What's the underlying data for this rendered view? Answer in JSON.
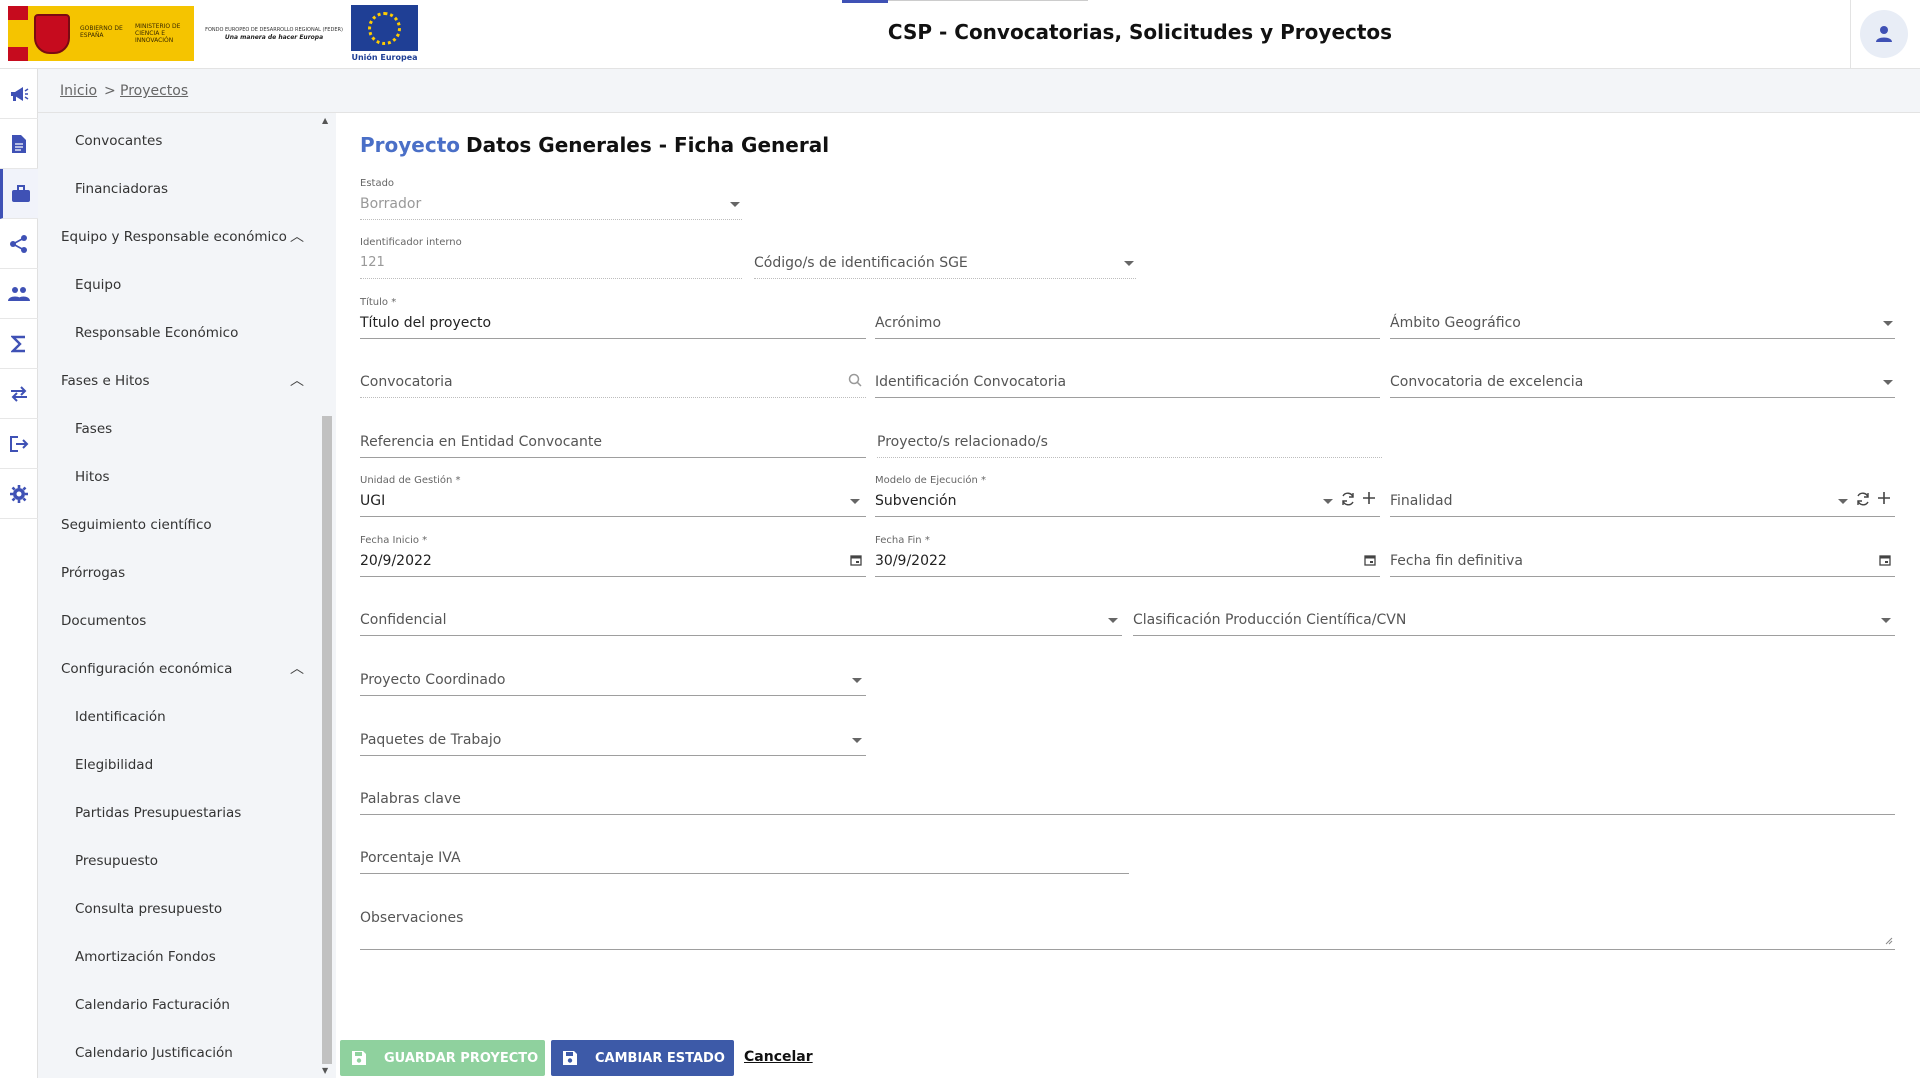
{
  "header": {
    "gov_line1": "GOBIERNO DE ESPAÑA",
    "gov_line2": "MINISTERIO DE CIENCIA E INNOVACIÓN",
    "feder_line1": "FONDO EUROPEO DE DESARROLLO REGIONAL (FEDER)",
    "feder_line2": "Una manera de hacer Europa",
    "eu_label": "Unión Europea",
    "title": "CSP - Convocatorias, Solicitudes y Proyectos"
  },
  "rail": {
    "icons": [
      "megaphone-icon",
      "document-icon",
      "briefcase-icon",
      "share-icon",
      "people-icon",
      "sigma-icon",
      "transfer-icon",
      "logout-icon",
      "gear-icon"
    ],
    "active_index": 2,
    "accent": "#3f51b5"
  },
  "breadcrumb": {
    "home": "Inicio",
    "separator": ">",
    "current": "Proyectos"
  },
  "nav": {
    "items": [
      {
        "label": "Convocantes"
      },
      {
        "label": "Financiadoras"
      },
      {
        "label": "Equipo y Responsable económico"
      },
      {
        "label": "Equipo"
      },
      {
        "label": "Responsable Económico"
      },
      {
        "label": "Fases e Hitos"
      },
      {
        "label": "Fases"
      },
      {
        "label": "Hitos"
      },
      {
        "label": "Seguimiento científico"
      },
      {
        "label": "Prórrogas"
      },
      {
        "label": "Documentos"
      },
      {
        "label": "Configuración económica"
      },
      {
        "label": "Identificación"
      },
      {
        "label": "Elegibilidad"
      },
      {
        "label": "Partidas Presupuestarias"
      },
      {
        "label": "Presupuesto"
      },
      {
        "label": "Consulta presupuesto"
      },
      {
        "label": "Amortización Fondos"
      },
      {
        "label": "Calendario Facturación"
      },
      {
        "label": "Calendario Justificación"
      }
    ]
  },
  "page": {
    "title_prefix": "Proyecto",
    "title": "Datos Generales - Ficha General"
  },
  "form": {
    "estado": {
      "label": "Estado",
      "value": "Borrador"
    },
    "identificador": {
      "label": "Identificador interno",
      "value": "121"
    },
    "codigo_sge": {
      "placeholder": "Código/s de identificación SGE"
    },
    "titulo": {
      "label": "Título *",
      "value": "Título del proyecto"
    },
    "acronimo": {
      "placeholder": "Acrónimo"
    },
    "ambito": {
      "placeholder": "Ámbito Geográfico"
    },
    "convocatoria": {
      "placeholder": "Convocatoria"
    },
    "id_convocatoria": {
      "placeholder": "Identificación Convocatoria"
    },
    "conv_excelencia": {
      "placeholder": "Convocatoria de excelencia"
    },
    "referencia": {
      "placeholder": "Referencia en Entidad Convocante"
    },
    "relacionados": {
      "placeholder": "Proyecto/s relacionado/s"
    },
    "unidad": {
      "label": "Unidad de Gestión *",
      "value": "UGI"
    },
    "modelo": {
      "label": "Modelo de Ejecución *",
      "value": "Subvención"
    },
    "finalidad": {
      "placeholder": "Finalidad"
    },
    "fecha_inicio": {
      "label": "Fecha Inicio *",
      "value": "20/9/2022"
    },
    "fecha_fin": {
      "label": "Fecha Fin *",
      "value": "30/9/2022"
    },
    "fecha_fin_def": {
      "placeholder": "Fecha fin definitiva"
    },
    "confidencial": {
      "placeholder": "Confidencial"
    },
    "clasificacion": {
      "placeholder": "Clasificación Producción Científica/CVN"
    },
    "coordinado": {
      "placeholder": "Proyecto Coordinado"
    },
    "paquetes": {
      "placeholder": "Paquetes de Trabajo"
    },
    "palabras": {
      "placeholder": "Palabras clave"
    },
    "iva": {
      "placeholder": "Porcentaje IVA"
    },
    "observaciones": {
      "placeholder": "Observaciones"
    }
  },
  "footer": {
    "save_label": "GUARDAR PROYECTO",
    "change_state_label": "CAMBIAR ESTADO",
    "cancel_label": "Cancelar"
  },
  "colors": {
    "accent": "#4a6fc7",
    "save_button": "#8fd19e",
    "state_button": "#3d5aa8",
    "nav_background": "#f3f5f8"
  }
}
